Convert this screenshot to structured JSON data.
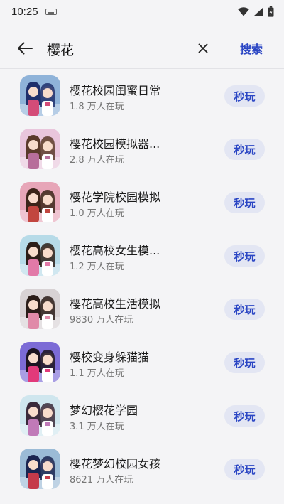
{
  "status_bar": {
    "time": "10:25",
    "icons": [
      "keyboard-icon",
      "wifi-icon",
      "signal-icon",
      "battery-charging-icon"
    ]
  },
  "search": {
    "back_icon": "back-arrow-icon",
    "query": "樱花",
    "clear_icon": "close-icon",
    "submit_label": "搜索"
  },
  "colors": {
    "accent": "#2b46c4",
    "button_bg": "#e3e6f3",
    "background": "#f4f4f6"
  },
  "results": [
    {
      "title": "樱花校园闺蜜日常",
      "players": "1.8 万人在玩",
      "action": "秒玩",
      "icon": {
        "bg": "#8fb3d9",
        "accent": "#d44c78",
        "hair": "#1f2f6b"
      }
    },
    {
      "title": "樱花校园模拟器...",
      "players": "2.8 万人在玩",
      "action": "秒玩",
      "icon": {
        "bg": "#e9c6dc",
        "accent": "#b76e9a",
        "hair": "#5a3a2a"
      }
    },
    {
      "title": "樱花学院校园模拟",
      "players": "1.0 万人在玩",
      "action": "秒玩",
      "icon": {
        "bg": "#e7a6b8",
        "accent": "#c2463f",
        "hair": "#3b2418"
      }
    },
    {
      "title": "樱花高校女生模...",
      "players": "1.2 万人在玩",
      "action": "秒玩",
      "icon": {
        "bg": "#b7dbe8",
        "accent": "#e27aa8",
        "hair": "#2c1e18"
      }
    },
    {
      "title": "樱花高校生活模拟",
      "players": "9830 万人在玩",
      "action": "秒玩",
      "icon": {
        "bg": "#d8d2d4",
        "accent": "#e08aa8",
        "hair": "#2a1c18"
      }
    },
    {
      "title": "樱校变身躲猫猫",
      "players": "1.1 万人在玩",
      "action": "秒玩",
      "icon": {
        "bg": "#7c6bd6",
        "accent": "#e23a7a",
        "hair": "#1c1420"
      }
    },
    {
      "title": "梦幻樱花学园",
      "players": "3.1 万人在玩",
      "action": "秒玩",
      "icon": {
        "bg": "#cfe6ee",
        "accent": "#c07ab8",
        "hair": "#3a2a3a"
      }
    },
    {
      "title": "樱花梦幻校园女孩",
      "players": "8621 万人在玩",
      "action": "秒玩",
      "icon": {
        "bg": "#9bbbd6",
        "accent": "#c53a4a",
        "hair": "#1a2450"
      }
    }
  ]
}
